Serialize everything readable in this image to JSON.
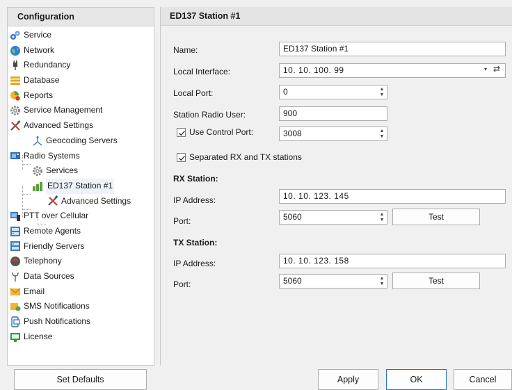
{
  "left_panel": {
    "title": "Configuration",
    "items": [
      {
        "label": "Service",
        "icon": "service-gears-icon"
      },
      {
        "label": "Network",
        "icon": "network-globe-icon"
      },
      {
        "label": "Redundancy",
        "icon": "redundancy-plug-icon"
      },
      {
        "label": "Database",
        "icon": "database-icon"
      },
      {
        "label": "Reports",
        "icon": "reports-icon"
      },
      {
        "label": "Service Management",
        "icon": "service-management-gear-icon"
      },
      {
        "label": "Advanced Settings",
        "icon": "advanced-settings-tools-icon"
      },
      {
        "label": "Geocoding Servers",
        "icon": "geocoding-servers-icon"
      },
      {
        "label": "Radio Systems",
        "icon": "radio-systems-icon"
      },
      {
        "label": "Services",
        "icon": "services-gear-icon"
      },
      {
        "label": "ED137 Station #1",
        "icon": "ed137-station-icon"
      },
      {
        "label": "Advanced Settings",
        "icon": "station-advanced-settings-icon"
      },
      {
        "label": "PTT over Cellular",
        "icon": "ptt-cellular-icon"
      },
      {
        "label": "Remote Agents",
        "icon": "remote-agents-icon"
      },
      {
        "label": "Friendly Servers",
        "icon": "friendly-servers-icon"
      },
      {
        "label": "Telephony",
        "icon": "telephony-icon"
      },
      {
        "label": "Data Sources",
        "icon": "data-sources-icon"
      },
      {
        "label": "Email",
        "icon": "email-icon"
      },
      {
        "label": "SMS Notifications",
        "icon": "sms-notifications-icon"
      },
      {
        "label": "Push Notifications",
        "icon": "push-notifications-icon"
      },
      {
        "label": "License",
        "icon": "license-icon"
      }
    ]
  },
  "right_panel": {
    "title": "ED137 Station #1",
    "name_label": "Name:",
    "name_value": "ED137 Station #1",
    "local_interface_label": "Local Interface:",
    "local_interface_value": "10. 10. 100. 99",
    "local_port_label": "Local Port:",
    "local_port_value": "0",
    "station_radio_user_label": "Station Radio User:",
    "station_radio_user_value": "900",
    "use_control_port_label": "Use Control Port:",
    "use_control_port_checked": true,
    "control_port_value": "3008",
    "separated_label": "Separated RX and TX stations",
    "separated_checked": true,
    "rx": {
      "title": "RX Station:",
      "ip_label": "IP Address:",
      "ip_value": "10. 10. 123. 145",
      "port_label": "Port:",
      "port_value": "5060",
      "test_label": "Test"
    },
    "tx": {
      "title": "TX Station:",
      "ip_label": "IP Address:",
      "ip_value": "10. 10. 123. 158",
      "port_label": "Port:",
      "port_value": "5060",
      "test_label": "Test"
    }
  },
  "bottom_bar": {
    "set_defaults_label": "Set Defaults",
    "apply_label": "Apply",
    "ok_label": "OK",
    "cancel_label": "Cancel"
  },
  "colors": {
    "accent": "#2a73c9",
    "header_bg": "#e6e6e6",
    "panel_bg": "#f0f0f0"
  }
}
